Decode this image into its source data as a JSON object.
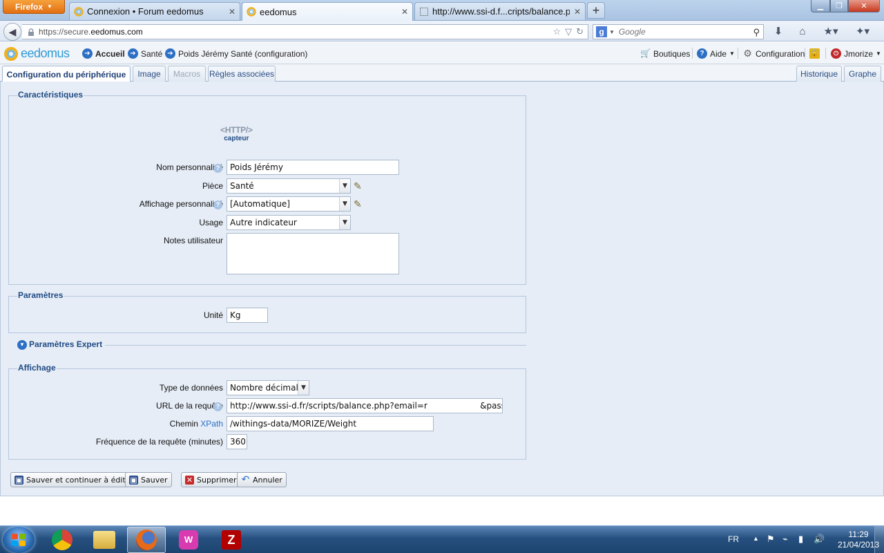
{
  "browser": {
    "menu_button": "Firefox",
    "tabs": [
      {
        "title": "Connexion • Forum eedomus",
        "close": "✕"
      },
      {
        "title": "eedomus",
        "close": "✕"
      },
      {
        "title": "http://www.ssi-d.f...cripts/balance.php",
        "close": "✕"
      }
    ],
    "new_tab": "+",
    "url_scheme": "https://secure.",
    "url_host": "eedomus.com",
    "search_placeholder": "Google"
  },
  "app": {
    "logo_text": "eedomus",
    "breadcrumbs": [
      {
        "label": "Accueil"
      },
      {
        "label": "Santé"
      },
      {
        "label": "Poids Jérémy Santé (configuration)"
      }
    ],
    "toolbar": {
      "boutiques": "Boutiques",
      "aide": "Aide",
      "configuration": "Configuration",
      "user": "Jmorize"
    }
  },
  "page_tabs": {
    "left": [
      "Configuration du périphérique",
      "Image",
      "Macros",
      "Règles associées"
    ],
    "right": [
      "Historique",
      "Graphe"
    ]
  },
  "caracteristiques": {
    "legend": "Caractéristiques",
    "device_type_http": "<HTTP/>",
    "device_type_label": "capteur",
    "nom_label": "Nom personnalisé",
    "nom_value": "Poids Jérémy",
    "piece_label": "Pièce",
    "piece_value": "Santé",
    "affichage_label": "Affichage personnalisé",
    "affichage_value": "[Automatique]",
    "usage_label": "Usage",
    "usage_value": "Autre indicateur",
    "notes_label": "Notes utilisateur",
    "notes_value": ""
  },
  "parametres": {
    "legend": "Paramètres",
    "unite_label": "Unité",
    "unite_value": "Kg"
  },
  "expert": {
    "label": "Paramètres Expert"
  },
  "affichage": {
    "legend": "Affichage",
    "type_label": "Type de données",
    "type_value": "Nombre décimal",
    "url_label": "URL de la requête",
    "url_value": "http://www.ssi-d.fr/scripts/balance.php?email=r                    &passwor",
    "xpath_label_a": "Chemin ",
    "xpath_label_b": "XPath",
    "xpath_value": "/withings-data/MORIZE/Weight",
    "freq_label": "Fréquence de la requête (minutes)",
    "freq_value": "360"
  },
  "actions": {
    "save_continue": "Sauver et continuer à éditer",
    "save": "Sauver",
    "delete": "Supprimer",
    "cancel": "Annuler"
  },
  "taskbar": {
    "lang": "FR",
    "time": "11:29",
    "date": "21/04/2013"
  },
  "colors": {
    "accent": "#1f4a84",
    "panel_bg": "#e6edf6",
    "firefox_orange": "#e36f12"
  }
}
